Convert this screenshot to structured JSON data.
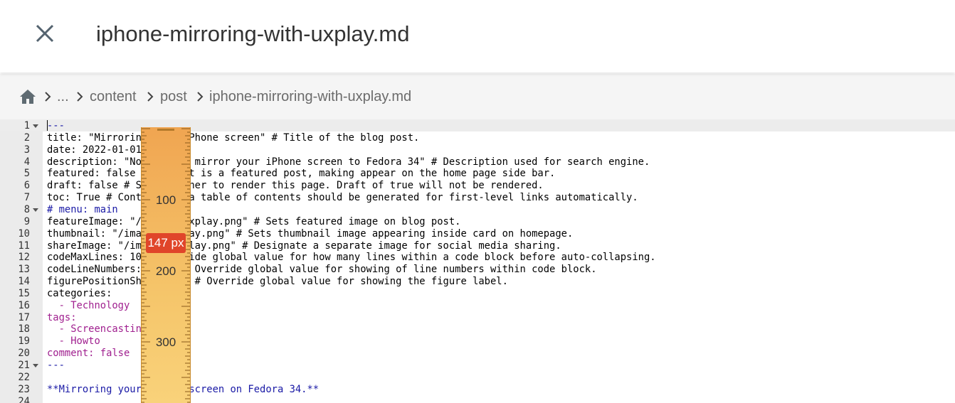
{
  "header": {
    "title": "iphone-mirroring-with-uxplay.md"
  },
  "breadcrumb": {
    "items": [
      "...",
      "content",
      "post",
      "iphone-mirroring-with-uxplay.md"
    ]
  },
  "editor": {
    "lines": [
      {
        "n": "1",
        "fold": true,
        "segments": [
          {
            "t": "---",
            "c": "blue"
          }
        ]
      },
      {
        "n": "2",
        "segments": [
          {
            "t": "title: \"Mirroring your iPhone screen\" # Title of the blog post."
          }
        ]
      },
      {
        "n": "3",
        "segments": [
          {
            "t": "date: 2022-01-01"
          }
        ]
      },
      {
        "n": "4",
        "segments": [
          {
            "t": "description: \"Now how to mirror your iPhone screen to Fedora 34\" # Description used for search engine."
          }
        ]
      },
      {
        "n": "5",
        "segments": [
          {
            "t": "featured: false # If post is a featured post, making appear on the home page side bar."
          }
        ]
      },
      {
        "n": "6",
        "segments": [
          {
            "t": "draft: false # Sets whether to render this page. Draft of true will not be rendered."
          }
        ]
      },
      {
        "n": "7",
        "segments": [
          {
            "t": "toc: True # Controls if a table of contents should be generated for first-level links automatically."
          }
        ]
      },
      {
        "n": "8",
        "fold": true,
        "segments": [
          {
            "t": "# menu: main",
            "c": "blue"
          }
        ]
      },
      {
        "n": "9",
        "segments": [
          {
            "t": "featureImage: \"/images/uxplay.png\" # Sets featured image on blog post."
          }
        ]
      },
      {
        "n": "10",
        "segments": [
          {
            "t": "thumbnail: \"/images/uxplay.png\" # Sets thumbnail image appearing inside card on homepage."
          }
        ]
      },
      {
        "n": "11",
        "segments": [
          {
            "t": "shareImage: \"/images/uxplay.png\" # Designate a separate image for social media sharing."
          }
        ]
      },
      {
        "n": "12",
        "segments": [
          {
            "t": "codeMaxLines: 10 # Override global value for how many lines within a code block before auto-collapsing."
          }
        ]
      },
      {
        "n": "13",
        "segments": [
          {
            "t": "codeLineNumbers: false # Override global value for showing of line numbers within code block."
          }
        ]
      },
      {
        "n": "14",
        "segments": [
          {
            "t": "figurePositionShow: true # Override global value for showing the figure label."
          }
        ]
      },
      {
        "n": "15",
        "segments": [
          {
            "t": "categories:"
          }
        ]
      },
      {
        "n": "16",
        "segments": [
          {
            "t": "  - Technology",
            "c": "magenta"
          }
        ]
      },
      {
        "n": "17",
        "segments": [
          {
            "t": "tags:",
            "c": "magenta"
          }
        ]
      },
      {
        "n": "18",
        "segments": [
          {
            "t": "  - Screencasting",
            "c": "magenta"
          }
        ]
      },
      {
        "n": "19",
        "segments": [
          {
            "t": "  - Howto",
            "c": "magenta"
          }
        ]
      },
      {
        "n": "20",
        "segments": [
          {
            "t": "comment: false",
            "c": "magenta"
          }
        ]
      },
      {
        "n": "21",
        "fold": true,
        "segments": [
          {
            "t": "---",
            "c": "blue"
          }
        ]
      },
      {
        "n": "22",
        "segments": [
          {
            "t": ""
          }
        ]
      },
      {
        "n": "23",
        "segments": [
          {
            "t": "**Mirroring your iPhone screen on Fedora 34.**",
            "c": "blue"
          }
        ]
      },
      {
        "n": "24",
        "segments": [
          {
            "t": ""
          }
        ]
      }
    ]
  },
  "ruler": {
    "labels": [
      "100",
      "200",
      "300"
    ],
    "measurement": "147 px"
  },
  "colors": {
    "accent_blue": "#1a1aa6",
    "accent_magenta": "#a0208f",
    "badge": "#e0452a"
  }
}
